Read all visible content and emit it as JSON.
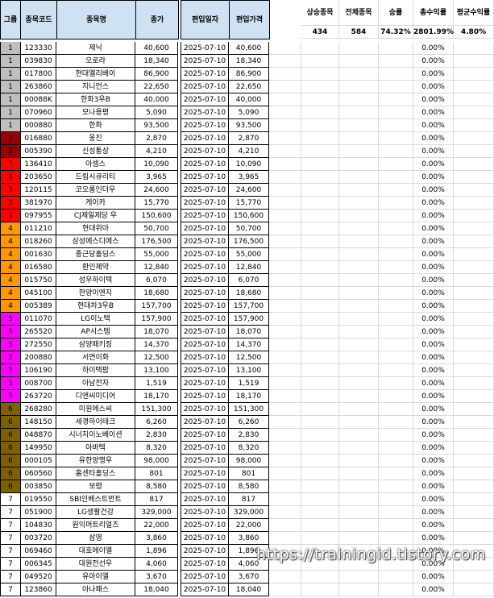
{
  "headers": {
    "group": "그룹",
    "code": "종목코드",
    "name": "종목명",
    "close": "종가",
    "date": "편입일자",
    "price": "편입가격"
  },
  "summary": {
    "labels": [
      "상승종목",
      "전체종목",
      "승률",
      "총수익률",
      "평균수익률"
    ],
    "values": [
      "434",
      "584",
      "74.32%",
      "2801.99%",
      "4.80%"
    ]
  },
  "group_colors": {
    "1": "#bfbfbf",
    "2": "#990000",
    "3": "#ff0000",
    "4": "#ff9900",
    "5": "#ff00ff",
    "6": "#7f6000",
    "7": "#ffffff"
  },
  "rows": [
    {
      "group": "1",
      "code": "123330",
      "name": "제닉",
      "close": "40,600",
      "date": "2025-07-10",
      "price": "40,600",
      "pct": "0.00%"
    },
    {
      "group": "1",
      "code": "039830",
      "name": "오로라",
      "close": "18,340",
      "date": "2025-07-10",
      "price": "18,340",
      "pct": "0.00%"
    },
    {
      "group": "1",
      "code": "017800",
      "name": "현대엘리베이",
      "close": "86,900",
      "date": "2025-07-10",
      "price": "86,900",
      "pct": "0.00%"
    },
    {
      "group": "1",
      "code": "263860",
      "name": "지니언스",
      "close": "22,650",
      "date": "2025-07-10",
      "price": "22,650",
      "pct": "0.00%"
    },
    {
      "group": "1",
      "code": "00088K",
      "name": "한화3우B",
      "close": "40,000",
      "date": "2025-07-10",
      "price": "40,000",
      "pct": "0.00%"
    },
    {
      "group": "1",
      "code": "070960",
      "name": "모나용평",
      "close": "5,090",
      "date": "2025-07-10",
      "price": "5,090",
      "pct": "0.00%"
    },
    {
      "group": "1",
      "code": "000880",
      "name": "한화",
      "close": "93,500",
      "date": "2025-07-10",
      "price": "93,500",
      "pct": "0.00%"
    },
    {
      "group": "2",
      "code": "016880",
      "name": "웅진",
      "close": "2,870",
      "date": "2025-07-10",
      "price": "2,870",
      "pct": "0.00%"
    },
    {
      "group": "2",
      "code": "005390",
      "name": "신성통상",
      "close": "4,210",
      "date": "2025-07-10",
      "price": "4,210",
      "pct": "0.00%"
    },
    {
      "group": "3",
      "code": "136410",
      "name": "아셈스",
      "close": "10,090",
      "date": "2025-07-10",
      "price": "10,090",
      "pct": "0.00%"
    },
    {
      "group": "3",
      "code": "203650",
      "name": "드림시큐리티",
      "close": "3,965",
      "date": "2025-07-10",
      "price": "3,965",
      "pct": "0.00%"
    },
    {
      "group": "3",
      "code": "120115",
      "name": "코오롱인더우",
      "close": "24,600",
      "date": "2025-07-10",
      "price": "24,600",
      "pct": "0.00%"
    },
    {
      "group": "3",
      "code": "381970",
      "name": "케이카",
      "close": "15,770",
      "date": "2025-07-10",
      "price": "15,770",
      "pct": "0.00%"
    },
    {
      "group": "3",
      "code": "097955",
      "name": "CJ제일제당 우",
      "close": "150,600",
      "date": "2025-07-10",
      "price": "150,600",
      "pct": "0.00%"
    },
    {
      "group": "4",
      "code": "011210",
      "name": "현대위아",
      "close": "50,700",
      "date": "2025-07-10",
      "price": "50,700",
      "pct": "0.00%"
    },
    {
      "group": "4",
      "code": "018260",
      "name": "삼성에스디에스",
      "close": "176,500",
      "date": "2025-07-10",
      "price": "176,500",
      "pct": "0.00%"
    },
    {
      "group": "4",
      "code": "001630",
      "name": "종근당홀딩스",
      "close": "55,000",
      "date": "2025-07-10",
      "price": "55,000",
      "pct": "0.00%"
    },
    {
      "group": "4",
      "code": "016580",
      "name": "환인제약",
      "close": "12,840",
      "date": "2025-07-10",
      "price": "12,840",
      "pct": "0.00%"
    },
    {
      "group": "4",
      "code": "015750",
      "name": "성우하이텍",
      "close": "6,070",
      "date": "2025-07-10",
      "price": "6,070",
      "pct": "0.00%"
    },
    {
      "group": "4",
      "code": "045100",
      "name": "한양이엔지",
      "close": "18,680",
      "date": "2025-07-10",
      "price": "18,680",
      "pct": "0.00%"
    },
    {
      "group": "4",
      "code": "005389",
      "name": "현대차3우B",
      "close": "157,700",
      "date": "2025-07-10",
      "price": "157,700",
      "pct": "0.00%"
    },
    {
      "group": "5",
      "code": "011070",
      "name": "LG이노텍",
      "close": "157,900",
      "date": "2025-07-10",
      "price": "157,900",
      "pct": "0.00%"
    },
    {
      "group": "5",
      "code": "265520",
      "name": "AP시스템",
      "close": "18,070",
      "date": "2025-07-10",
      "price": "18,070",
      "pct": "0.00%"
    },
    {
      "group": "5",
      "code": "272550",
      "name": "삼양패키징",
      "close": "14,370",
      "date": "2025-07-10",
      "price": "14,370",
      "pct": "0.00%"
    },
    {
      "group": "5",
      "code": "200880",
      "name": "서연이화",
      "close": "12,500",
      "date": "2025-07-10",
      "price": "12,500",
      "pct": "0.00%"
    },
    {
      "group": "5",
      "code": "106190",
      "name": "하이텍팜",
      "close": "13,100",
      "date": "2025-07-10",
      "price": "13,100",
      "pct": "0.00%"
    },
    {
      "group": "5",
      "code": "008700",
      "name": "아남전자",
      "close": "1,519",
      "date": "2025-07-10",
      "price": "1,519",
      "pct": "0.00%"
    },
    {
      "group": "5",
      "code": "263720",
      "name": "디앤씨미디어",
      "close": "18,170",
      "date": "2025-07-10",
      "price": "18,170",
      "pct": "0.00%"
    },
    {
      "group": "6",
      "code": "268280",
      "name": "미원에스씨",
      "close": "151,300",
      "date": "2025-07-10",
      "price": "151,300",
      "pct": "0.00%"
    },
    {
      "group": "6",
      "code": "148150",
      "name": "세경하이테크",
      "close": "6,260",
      "date": "2025-07-10",
      "price": "6,260",
      "pct": "0.00%"
    },
    {
      "group": "6",
      "code": "048870",
      "name": "시너지이노베이션",
      "close": "2,830",
      "date": "2025-07-10",
      "price": "2,830",
      "pct": "0.00%"
    },
    {
      "group": "6",
      "code": "149950",
      "name": "아바텍",
      "close": "8,320",
      "date": "2025-07-10",
      "price": "8,320",
      "pct": "0.00%"
    },
    {
      "group": "6",
      "code": "000105",
      "name": "유한양행우",
      "close": "98,000",
      "date": "2025-07-10",
      "price": "98,000",
      "pct": "0.00%"
    },
    {
      "group": "6",
      "code": "060560",
      "name": "홈센타홀딩스",
      "close": "801",
      "date": "2025-07-10",
      "price": "801",
      "pct": "0.00%"
    },
    {
      "group": "6",
      "code": "003850",
      "name": "보령",
      "close": "8,580",
      "date": "2025-07-10",
      "price": "8,580",
      "pct": "0.00%"
    },
    {
      "group": "7",
      "code": "019550",
      "name": "SBI인베스트먼트",
      "close": "817",
      "date": "2025-07-10",
      "price": "817",
      "pct": "0.00%"
    },
    {
      "group": "7",
      "code": "051900",
      "name": "LG생활건강",
      "close": "329,000",
      "date": "2025-07-10",
      "price": "329,000",
      "pct": "0.00%"
    },
    {
      "group": "7",
      "code": "104830",
      "name": "원익머트리얼즈",
      "close": "22,000",
      "date": "2025-07-10",
      "price": "22,000",
      "pct": "0.00%"
    },
    {
      "group": "7",
      "code": "003720",
      "name": "삼영",
      "close": "3,860",
      "date": "2025-07-10",
      "price": "3,860",
      "pct": "0.00%"
    },
    {
      "group": "7",
      "code": "069460",
      "name": "대호에이엘",
      "close": "1,896",
      "date": "2025-07-10",
      "price": "1,896",
      "pct": "0.00%"
    },
    {
      "group": "7",
      "code": "006345",
      "name": "대원전선우",
      "close": "4,060",
      "date": "2025-07-10",
      "price": "4,060",
      "pct": "0.00%"
    },
    {
      "group": "7",
      "code": "049520",
      "name": "유아이엘",
      "close": "3,670",
      "date": "2025-07-10",
      "price": "3,670",
      "pct": "0.00%"
    },
    {
      "group": "7",
      "code": "123860",
      "name": "아나패스",
      "close": "18,040",
      "date": "2025-07-10",
      "price": "18,040",
      "pct": "0.00%"
    }
  ],
  "watermark": "https://trainingid.tistory.com"
}
